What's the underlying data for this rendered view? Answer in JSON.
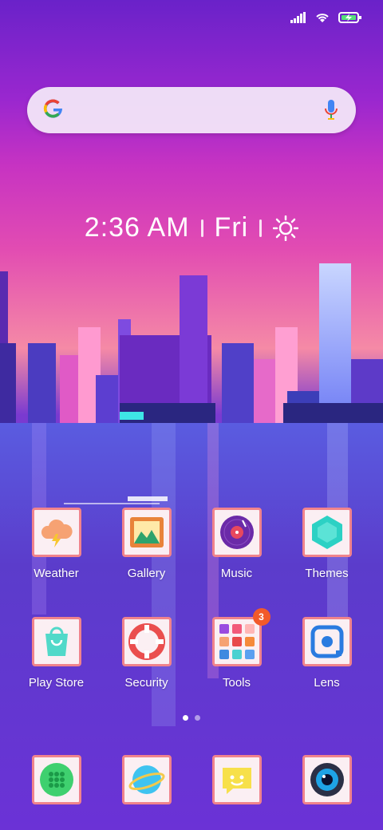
{
  "status": {
    "icons": [
      "signal-icon",
      "wifi-icon",
      "battery-charging-icon"
    ]
  },
  "search": {
    "logo": "google-g-logo",
    "mic": "mic-icon"
  },
  "clock": {
    "time": "2:36 AM",
    "day": "Fri",
    "weather_icon": "sun-icon"
  },
  "apps_row1": [
    {
      "label": "Weather",
      "icon": "weather-icon"
    },
    {
      "label": "Gallery",
      "icon": "gallery-icon"
    },
    {
      "label": "Music",
      "icon": "music-icon"
    },
    {
      "label": "Themes",
      "icon": "themes-icon"
    }
  ],
  "apps_row2": [
    {
      "label": "Play Store",
      "icon": "play-store-icon"
    },
    {
      "label": "Security",
      "icon": "security-icon"
    },
    {
      "label": "Tools",
      "icon": "tools-folder-icon",
      "badge": "3"
    },
    {
      "label": "Lens",
      "icon": "lens-icon"
    }
  ],
  "pager": {
    "pages": 2,
    "current": 1
  },
  "dock": [
    "phone-icon",
    "browser-icon",
    "messages-icon",
    "camera-icon"
  ],
  "colors": {
    "icon_border": "#f0838c",
    "badge": "#f25a2b"
  }
}
